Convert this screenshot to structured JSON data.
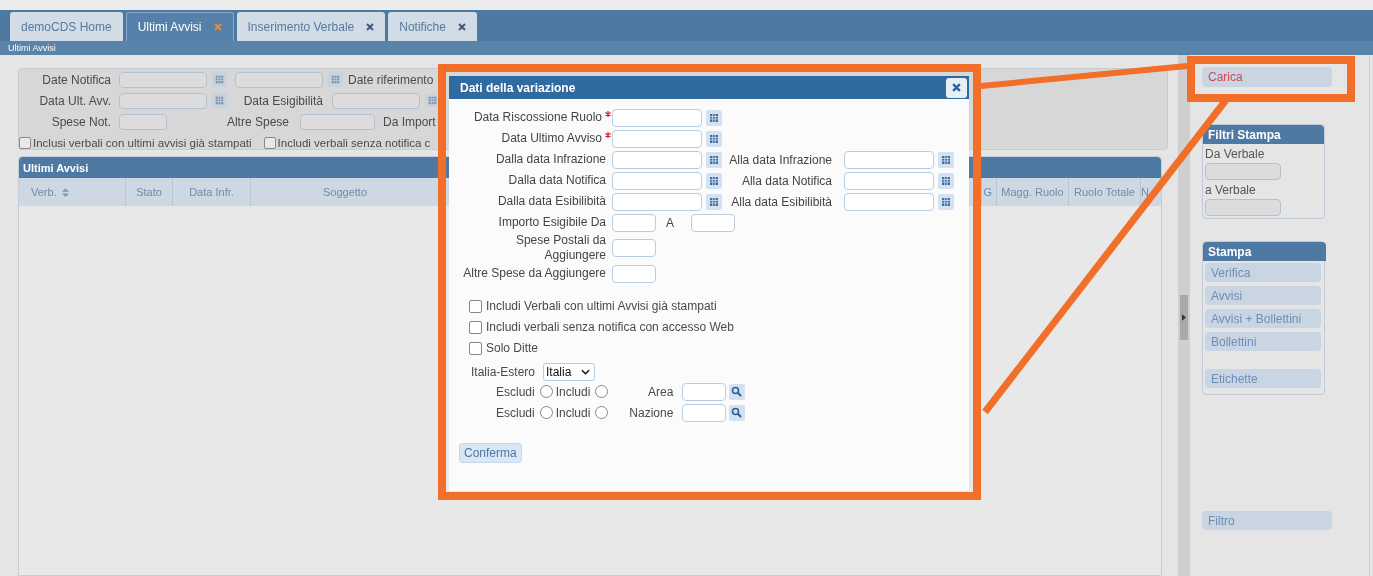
{
  "tabs": [
    {
      "label": "demoCDS Home",
      "selected": false,
      "closable": false
    },
    {
      "label": "Ultimi Avvisi",
      "selected": true,
      "closable": true
    },
    {
      "label": "Inserimento Verbale",
      "selected": false,
      "closable": true
    },
    {
      "label": "Notifiche",
      "selected": false,
      "closable": true
    }
  ],
  "breadcrumb": "Ultimi Avvisi",
  "filter_panel": {
    "date_notifica": "Date Notifica",
    "date_riferimento": "Date riferimento",
    "data_ult_avv": "Data Ult. Avv.",
    "data_esigibilita": "Data Esigibilità",
    "spese_not": "Spese Not.",
    "altre_spese": "Altre Spese",
    "da_importo": "Da Import",
    "checkboxes": [
      {
        "label": "Inclusi verbali con ultimi avvisi già stampati",
        "checked": false
      },
      {
        "label": "Includi verbali senza notifica c",
        "checked": false
      }
    ]
  },
  "grid": {
    "title": "Ultimi Avvisi",
    "columns": [
      {
        "label": "Verb.",
        "sorted": true
      },
      {
        "label": "Stato",
        "sorted": false
      },
      {
        "label": "Data Infr.",
        "sorted": false
      },
      {
        "label": "Soggetto",
        "sorted": false
      }
    ],
    "columns_right": [
      {
        "label": "G",
        "sorted": false
      },
      {
        "label": "Magg. Ruolo",
        "sorted": false
      },
      {
        "label": "Ruolo Totale",
        "sorted": false
      },
      {
        "label": "N",
        "sorted": false
      }
    ]
  },
  "sidebar": {
    "load_button": "Carica",
    "print_filters": {
      "title": "Filtri Stampa",
      "fields": [
        "Da Verbale",
        "a Verbale"
      ]
    },
    "print": {
      "title": "Stampa",
      "buttons": [
        "Verifica",
        "Avvisi",
        "Avvisi + Bollettini",
        "Bollettini"
      ],
      "extra_buttons": [
        "Etichette"
      ]
    },
    "filter_button": "Filtro"
  },
  "dialog": {
    "title": "Dati della variazione",
    "rows": [
      {
        "kind": "date",
        "label": "Data Riscossione Ruolo",
        "required": true
      },
      {
        "kind": "date",
        "label": "Data Ultimo Avviso",
        "required": true
      },
      {
        "kind": "date_range",
        "label": "Dalla data Infrazione",
        "required": false,
        "second_label": "Alla data Infrazione"
      },
      {
        "kind": "date_range",
        "label": "Dalla data Notifica",
        "required": false,
        "second_label": "Alla data Notifica"
      },
      {
        "kind": "date_range",
        "label": "Dalla data Esibilibità",
        "required": false,
        "second_label": "Alla data Esibilibità"
      },
      {
        "kind": "amount_range",
        "label": "Importo Esigibile Da",
        "required": false,
        "second_label": "A"
      },
      {
        "kind": "amount",
        "label": "Spese Postali da Aggiungere",
        "required": false
      },
      {
        "kind": "amount",
        "label": "Altre Spese da Aggiungere",
        "required": false
      }
    ],
    "checkboxes": [
      {
        "label": "Includi Verbali con ultimi Avvisi già stampati",
        "checked": false
      },
      {
        "label": "Includi verbali senza notifica con accesso Web",
        "checked": false
      },
      {
        "label": "Solo Ditte",
        "checked": false
      }
    ],
    "select": {
      "label": "Italia-Estero",
      "value": "Italia"
    },
    "radio_rows": [
      {
        "options": [
          {
            "label": "Escludi",
            "selected": false
          },
          {
            "label": "Includi",
            "selected": false
          }
        ],
        "field_label": "Area"
      },
      {
        "options": [
          {
            "label": "Escludi",
            "selected": false
          },
          {
            "label": "Includi",
            "selected": false
          }
        ],
        "field_label": "Nazione"
      }
    ],
    "confirm_button": "Conferma"
  }
}
